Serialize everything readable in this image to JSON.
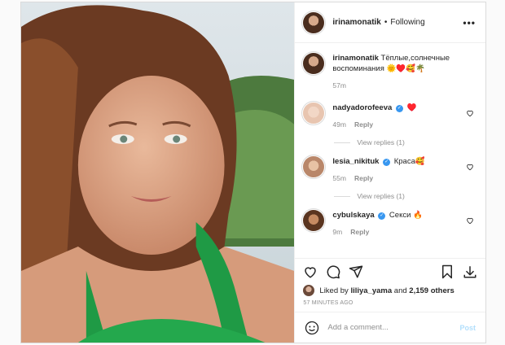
{
  "post": {
    "author": "irinamonatik",
    "separator": "•",
    "follow_status": "Following",
    "more": "•••"
  },
  "caption": {
    "username": "irinamonatik",
    "text": "Тёплые,солнечные воспоминания 🌞♥️🥰🌴",
    "time": "57m"
  },
  "comments": [
    {
      "username": "nadyadorofeeva",
      "verified": true,
      "text": "♥️",
      "time": "49m",
      "reply": "Reply",
      "view_replies": "View replies (1)"
    },
    {
      "username": "lesia_nikituk",
      "verified": true,
      "text": "Краса🥰",
      "time": "55m",
      "reply": "Reply",
      "view_replies": "View replies (1)"
    },
    {
      "username": "cybulskaya",
      "verified": true,
      "text": "Секси 🔥",
      "time": "9m",
      "reply": "Reply"
    }
  ],
  "likes": {
    "prefix": "Liked by",
    "user": "liliya_yama",
    "and": "and",
    "count": "2,159 others"
  },
  "timestamp": "57 MINUTES AGO",
  "composer": {
    "placeholder": "Add a comment...",
    "post_label": "Post"
  },
  "icons": [
    "heart-icon",
    "comment-icon",
    "share-icon",
    "bookmark-icon",
    "download-icon",
    "smiley-icon",
    "more-icon"
  ],
  "colors": {
    "verified": "#3897f0",
    "post_disabled": "#b2dffc",
    "muted": "#8e8e8e"
  }
}
